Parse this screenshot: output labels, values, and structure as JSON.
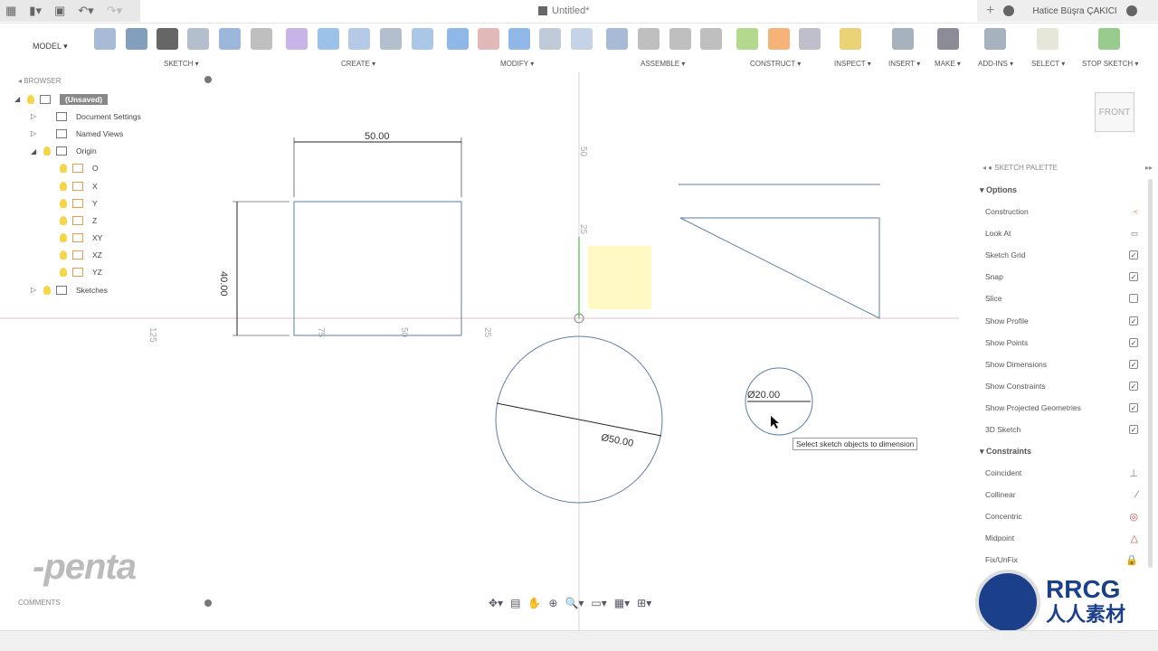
{
  "app": {
    "doc_title": "Untitled*",
    "user": "Hatice Büşra ÇAKICI"
  },
  "toolbar": {
    "workspace": "MODEL",
    "groups": [
      "SKETCH ▾",
      "CREATE ▾",
      "MODIFY ▾",
      "ASSEMBLE ▾",
      "CONSTRUCT ▾",
      "INSPECT ▾",
      "INSERT ▾",
      "MAKE ▾",
      "ADD-INS ▾",
      "SELECT ▾",
      "STOP SKETCH ▾"
    ]
  },
  "browser": {
    "title": "BROWSER",
    "items": [
      {
        "label": "(Unsaved)",
        "level": 0,
        "icon": "component-icon"
      },
      {
        "label": "Document Settings",
        "level": 1,
        "icon": "gear-icon"
      },
      {
        "label": "Named Views",
        "level": 1,
        "icon": "folder-icon"
      },
      {
        "label": "Origin",
        "level": 1,
        "icon": "folder-icon"
      },
      {
        "label": "O",
        "level": 2,
        "icon": "origin-point-icon"
      },
      {
        "label": "X",
        "level": 2,
        "icon": "axis-icon"
      },
      {
        "label": "Y",
        "level": 2,
        "icon": "axis-icon"
      },
      {
        "label": "Z",
        "level": 2,
        "icon": "axis-icon"
      },
      {
        "label": "XY",
        "level": 2,
        "icon": "plane-icon"
      },
      {
        "label": "XZ",
        "level": 2,
        "icon": "plane-icon"
      },
      {
        "label": "YZ",
        "level": 2,
        "icon": "plane-icon"
      },
      {
        "label": "Sketches",
        "level": 1,
        "icon": "folder-icon"
      }
    ]
  },
  "canvas": {
    "dims": {
      "rect_width": "50.00",
      "rect_height": "40.00",
      "circle_big": "Ø50.00",
      "circle_small": "Ø20.00"
    },
    "ruler": {
      "top": "50",
      "mid": "25",
      "left": "125",
      "r75": "75",
      "r50": "50",
      "r25": "25"
    },
    "tooltip": "Select sketch objects to dimension",
    "viewcube": "FRONT"
  },
  "palette": {
    "title": "SKETCH PALETTE",
    "options_header": "Options",
    "options": [
      {
        "label": "Construction",
        "type": "icon",
        "icon": "construction-icon"
      },
      {
        "label": "Look At",
        "type": "icon",
        "icon": "look-at-icon"
      },
      {
        "label": "Sketch Grid",
        "type": "check",
        "checked": true
      },
      {
        "label": "Snap",
        "type": "check",
        "checked": true
      },
      {
        "label": "Slice",
        "type": "check",
        "checked": false
      },
      {
        "label": "Show Profile",
        "type": "check",
        "checked": true
      },
      {
        "label": "Show Points",
        "type": "check",
        "checked": true
      },
      {
        "label": "Show Dimensions",
        "type": "check",
        "checked": true
      },
      {
        "label": "Show Constraints",
        "type": "check",
        "checked": true
      },
      {
        "label": "Show Projected Geometries",
        "type": "check",
        "checked": true
      },
      {
        "label": "3D Sketch",
        "type": "check",
        "checked": true
      }
    ],
    "constraints_header": "Constraints",
    "constraints": [
      {
        "label": "Coincident",
        "glyph": "⊥",
        "color": "#777"
      },
      {
        "label": "Collinear",
        "glyph": "⁄",
        "color": "#777"
      },
      {
        "label": "Concentric",
        "glyph": "◎",
        "color": "#d05050"
      },
      {
        "label": "Midpoint",
        "glyph": "△",
        "color": "#d05050"
      },
      {
        "label": "Fix/UnFix",
        "glyph": "🔒",
        "color": "#e09030"
      }
    ]
  },
  "comments": {
    "title": "COMMENTS"
  },
  "watermarks": {
    "penta": "-penta",
    "rrcg": "RRCG",
    "rrcg_sub": "人人素材"
  }
}
